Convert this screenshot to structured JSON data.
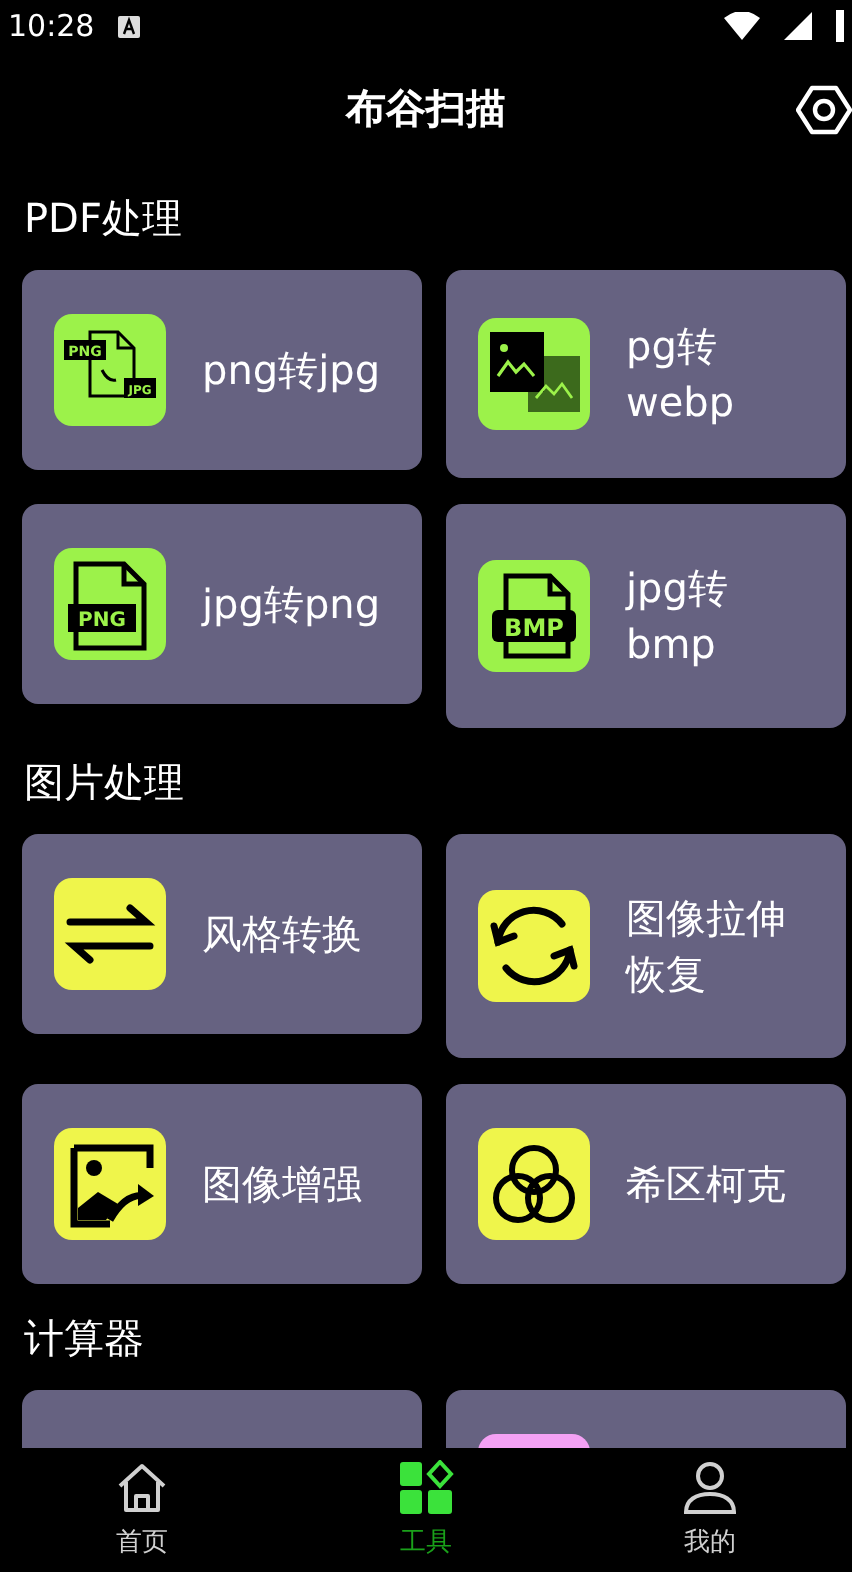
{
  "status_bar": {
    "time": "10:28"
  },
  "header": {
    "title": "布谷扫描"
  },
  "sections": [
    {
      "title": "PDF处理",
      "color": "#9cf24a",
      "items": [
        {
          "kind": "png-jpg",
          "badges": [
            "PNG",
            "JPG"
          ],
          "lines": [
            "png转jpg"
          ]
        },
        {
          "kind": "images",
          "lines": [
            "pg转",
            "webp"
          ]
        },
        {
          "kind": "png-file",
          "badges": [
            "PNG"
          ],
          "lines": [
            "jpg转png"
          ]
        },
        {
          "kind": "bmp-file",
          "badges": [
            "BMP"
          ],
          "lines": [
            "jpg转",
            "bmp"
          ]
        }
      ]
    },
    {
      "title": "图片处理",
      "color": "#eff54b",
      "items": [
        {
          "kind": "swap",
          "lines": [
            "风格转换"
          ]
        },
        {
          "kind": "refresh",
          "lines": [
            "图像拉伸",
            "恢复"
          ]
        },
        {
          "kind": "enhance",
          "lines": [
            "图像增强"
          ]
        },
        {
          "kind": "circles",
          "lines": [
            "希区柯克"
          ]
        }
      ]
    },
    {
      "title": "计算器",
      "color": "#f4a1f4",
      "items": [
        {
          "kind": "none"
        },
        {
          "kind": "tile"
        }
      ]
    }
  ],
  "nav": [
    {
      "label": "首页",
      "kind": "home",
      "selected": false
    },
    {
      "label": "工具",
      "kind": "tools",
      "selected": true
    },
    {
      "label": "我的",
      "kind": "person",
      "selected": false
    }
  ]
}
